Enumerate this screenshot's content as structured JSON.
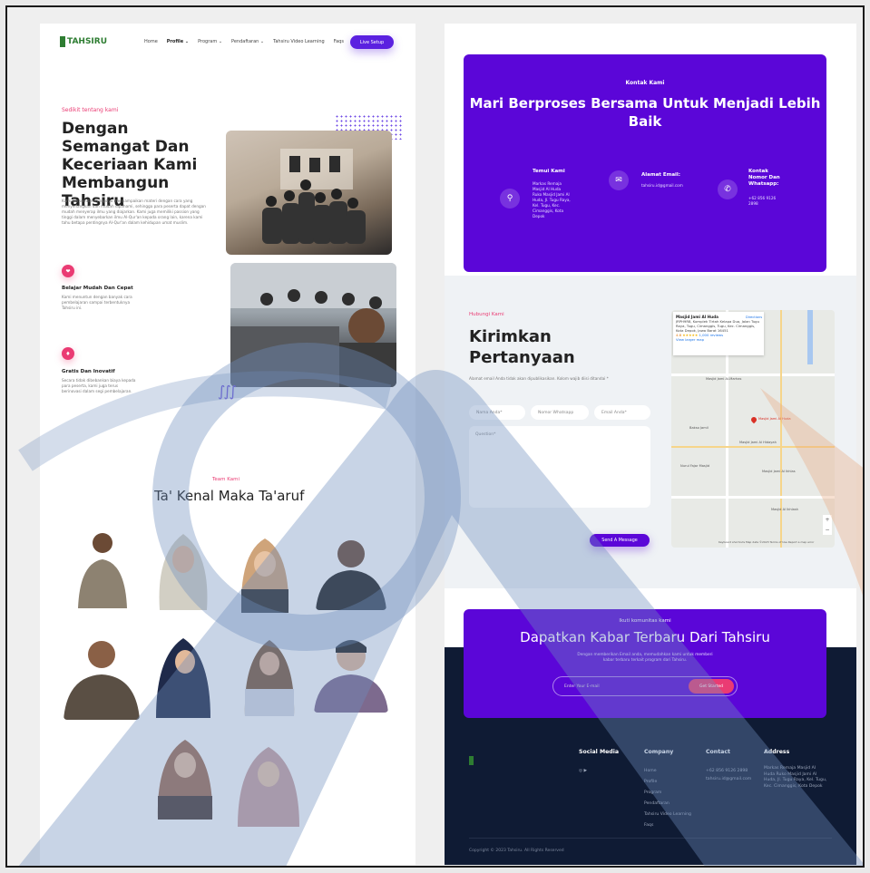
{
  "left_page": {
    "logo": "TAHSIRU",
    "nav": [
      "Home",
      "Profile",
      "Program",
      "Pendaftaran",
      "Tahsiru Video Learning",
      "Faqs"
    ],
    "nav_active": "Profile",
    "cta": "Live Setup",
    "eyebrow": "Sedikit tentang kami",
    "title": "Dengan Semangat Dan Keceriaan Kami Membangun Tahsiru",
    "intro": "Kami berkomitmen supaya menyampaikan materi dengan cara yang menyenangkan dan mudah dipahami, sehingga para peserta dapat dengan mudah menyerap ilmu yang diajarkan. Kami juga memiliki passion yang tinggi dalam menyebarkan ilmu Al-Qur'an kepada orang lain, karena kami tahu betapa pentingnya Al-Qur'an dalam kehidupan umat muslim.",
    "features": [
      {
        "title": "Belajar Mudah Dan Cepat",
        "desc": "Kami menuntun dengan banyak cara pembelajaran sampai terbentuknya Tahsiru ini."
      },
      {
        "title": "Gratis Dan Inovatif",
        "desc": "Secara tidak dibebankan biaya kepada para peserta, kami juga terus berinovasi dalam segi pembelajaran."
      }
    ],
    "team_eyebrow": "Team Kami",
    "team_title": "Ta' Kenal Maka Ta'aruf"
  },
  "right_page": {
    "contact": {
      "eyebrow": "Kontak Kami",
      "title": "Mari Berproses Bersama Untuk Menjadi Lebih Baik",
      "items": [
        {
          "icon": "location-icon",
          "label": "Temui Kami",
          "value": "Markas Remaja Masjid Al Huda Ruko Masjid Jami Al Huda, Jl. Tugu Raya, Kel. Tugu, Kec. Cimanggis, Kota Depok"
        },
        {
          "icon": "email-icon",
          "label": "Alamat Email:",
          "value": "tahsiru.id@gmail.com"
        },
        {
          "icon": "phone-icon",
          "label": "Kontak Nomor Dan Whatsapp:",
          "value": "+62 856 9126 2898"
        }
      ]
    },
    "ask": {
      "eyebrow": "Hubungi Kami",
      "title": "Kirimkan Pertanyaan",
      "desc": "Alamat email Anda tidak akan dipublikasikan. Kolom wajib diisi ditandai *",
      "name_placeholder": "Nama Anda*",
      "wa_placeholder": "Nomor Whatsapp",
      "email_placeholder": "Email Anda*",
      "question_placeholder": "Question*",
      "send": "Send A Message"
    },
    "map": {
      "place": "Masjid Jami Al Huda",
      "address": "JRPH9R8, Komplek Tirtah Kelapa Dua, Jalan Tugu Raya, Tugu, Cimanggis, Tugu, Kec. Cimanggis, Kota Depok, Jawa Barat 16451",
      "rating": "4.8",
      "reviews": "1,000 reviews",
      "directions": "Directions",
      "larger": "View larger map",
      "labels": [
        "Masjid Jami Al-Marhas",
        "Masjid Jami Al Huda",
        "Masjid Jami Al Hidayah",
        "Masjid Al Ikhlash",
        "Bakso Jamil",
        "Nurul Fajar Masjid",
        "Masjid Jami Al Ikhlas"
      ],
      "footer": "Keyboard shortcuts  Map data ©2023  Terms of Use  Report a map error"
    },
    "newsletter": {
      "eyebrow": "Ikuti komunitas kami",
      "title": "Dapatkan Kabar Terbaru Dari Tahsiru",
      "desc": "Dengan memberikan Email anda, memudahkan kami untuk memberi kabar terbaru terkait program dari Tahsiru.",
      "placeholder": "Enter Your E-mail",
      "button": "Get Started"
    },
    "footer": {
      "social_title": "Social Media",
      "company_title": "Company",
      "company_items": [
        "Home",
        "Profile",
        "Program",
        "Pendaftaran",
        "Tahsiru Video Learning",
        "Faqs"
      ],
      "contact_title": "Contact",
      "contact_items": [
        "+62 856 9126 2898",
        "tahsiru.id@gmail.com"
      ],
      "address_title": "Address",
      "address": "Markas Remaja Masjid Al Huda Ruko Masjid Jami Al Huda, Jl. Tugu Raya, Kel. Tugu, Kec. Cimanggis, Kota Depok",
      "copyright": "Copyright © 2023 Tahsiru. All Rights Reserved"
    }
  },
  "colors": {
    "primary": "#5b06d8",
    "accent": "#ea3b73",
    "footer": "#0f1b34",
    "brand": "#2e7d32"
  }
}
